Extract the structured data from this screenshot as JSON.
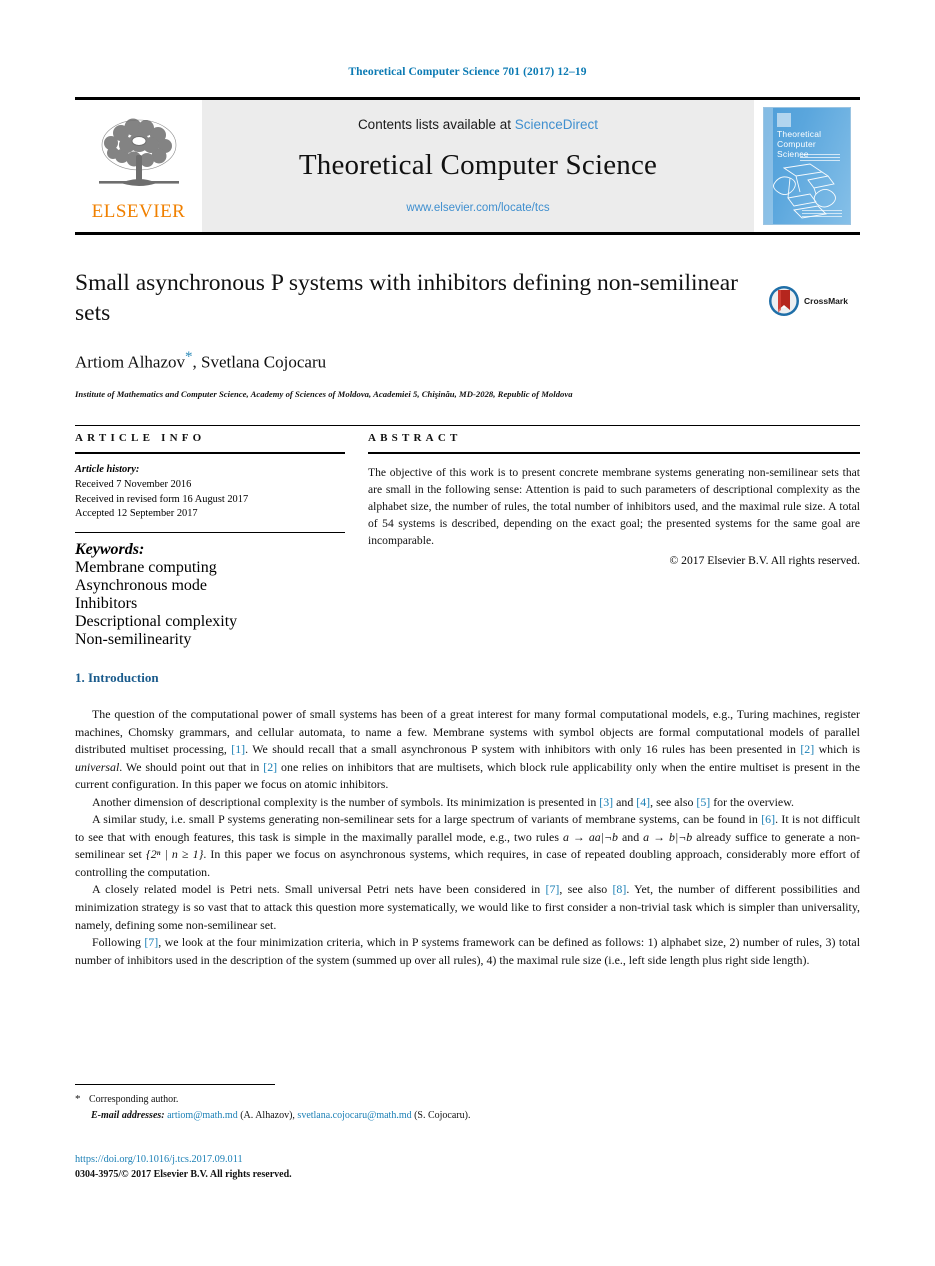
{
  "running_head": "Theoretical Computer Science 701 (2017) 12–19",
  "masthead": {
    "publisher_name": "ELSEVIER",
    "contents_prefix": "Contents lists available at ",
    "sciencedirect": "ScienceDirect",
    "journal_title": "Theoretical Computer Science",
    "journal_url": "www.elsevier.com/locate/tcs",
    "cover_title_line1": "Theoretical",
    "cover_title_line2": "Computer Science"
  },
  "article": {
    "title": "Small asynchronous P systems with inhibitors defining non-semilinear sets",
    "authors": "Artiom Alhazov",
    "authors_rest": ", Svetlana Cojocaru",
    "corresponding_mark": "*",
    "affiliation": "Institute of Mathematics and Computer Science, Academy of Sciences of Moldova, Academiei 5, Chişinău, MD-2028, Republic of Moldova",
    "crossmark_label": "CrossMark"
  },
  "info": {
    "heading": "ARTICLE INFO",
    "history_label": "Article history:",
    "history": [
      "Received 7 November 2016",
      "Received in revised form 16 August 2017",
      "Accepted 12 September 2017"
    ],
    "keywords_label": "Keywords:",
    "keywords": [
      "Membrane computing",
      "Asynchronous mode",
      "Inhibitors",
      "Descriptional complexity",
      "Non-semilinearity"
    ]
  },
  "abstract": {
    "heading": "ABSTRACT",
    "text": "The objective of this work is to present concrete membrane systems generating non-semilinear sets that are small in the following sense: Attention is paid to such parameters of descriptional complexity as the alphabet size, the number of rules, the total number of inhibitors used, and the maximal rule size. A total of 54 systems is described, depending on the exact goal; the presented systems for the same goal are incomparable.",
    "copyright": "© 2017 Elsevier B.V. All rights reserved."
  },
  "body": {
    "section_number": "1.",
    "section_title": "Introduction",
    "paragraphs": [
      {
        "id": "p1",
        "parts": [
          {
            "t": "text",
            "v": "The question of the computational power of small systems has been of a great interest for many formal computational models, e.g., Turing machines, register machines, Chomsky grammars, and cellular automata, to name a few. Membrane systems with symbol objects are formal computational models of parallel distributed multiset processing, "
          },
          {
            "t": "ref",
            "v": "[1]"
          },
          {
            "t": "text",
            "v": ". We should recall that a small asynchronous P system with inhibitors with only 16 rules has been presented in "
          },
          {
            "t": "ref",
            "v": "[2]"
          },
          {
            "t": "text",
            "v": " which is "
          },
          {
            "t": "italic",
            "v": "universal"
          },
          {
            "t": "text",
            "v": ". We should point out that in "
          },
          {
            "t": "ref",
            "v": "[2]"
          },
          {
            "t": "text",
            "v": " one relies on inhibitors that are multisets, which block rule applicability only when the entire multiset is present in the current configuration. In this paper we focus on atomic inhibitors."
          }
        ]
      },
      {
        "id": "p2",
        "parts": [
          {
            "t": "text",
            "v": "Another dimension of descriptional complexity is the number of symbols. Its minimization is presented in "
          },
          {
            "t": "ref",
            "v": "[3]"
          },
          {
            "t": "text",
            "v": " and "
          },
          {
            "t": "ref",
            "v": "[4]"
          },
          {
            "t": "text",
            "v": ", see also "
          },
          {
            "t": "ref",
            "v": "[5]"
          },
          {
            "t": "text",
            "v": " for the overview."
          }
        ]
      },
      {
        "id": "p3",
        "parts": [
          {
            "t": "text",
            "v": "A similar study, i.e. small P systems generating non-semilinear sets for a large spectrum of variants of membrane systems, can be found in "
          },
          {
            "t": "ref",
            "v": "[6]"
          },
          {
            "t": "text",
            "v": ". It is not difficult to see that with enough features, this task is simple in the maximally parallel mode, e.g., two rules "
          },
          {
            "t": "math",
            "v": "a → aa|¬b"
          },
          {
            "t": "text",
            "v": " and "
          },
          {
            "t": "math",
            "v": "a → b|¬b"
          },
          {
            "t": "text",
            "v": " already suffice to generate a non-semilinear set "
          },
          {
            "t": "math",
            "v": "{2ⁿ | n ≥ 1}"
          },
          {
            "t": "text",
            "v": ". In this paper we focus on asynchronous systems, which requires, in case of repeated doubling approach, considerably more effort of controlling the computation."
          }
        ]
      },
      {
        "id": "p4",
        "parts": [
          {
            "t": "text",
            "v": "A closely related model is Petri nets. Small universal Petri nets have been considered in "
          },
          {
            "t": "ref",
            "v": "[7]"
          },
          {
            "t": "text",
            "v": ", see also "
          },
          {
            "t": "ref",
            "v": "[8]"
          },
          {
            "t": "text",
            "v": ". Yet, the number of different possibilities and minimization strategy is so vast that to attack this question more systematically, we would like to first consider a non-trivial task which is simpler than universality, namely, defining some non-semilinear set."
          }
        ]
      },
      {
        "id": "p5",
        "parts": [
          {
            "t": "text",
            "v": "Following "
          },
          {
            "t": "ref",
            "v": "[7]"
          },
          {
            "t": "text",
            "v": ", we look at the four minimization criteria, which in P systems framework can be defined as follows: 1) alphabet size, 2) number of rules, 3) total number of inhibitors used in the description of the system (summed up over all rules), 4) the maximal rule size (i.e., left side length plus right side length)."
          }
        ]
      }
    ]
  },
  "footnotes": {
    "corresponding_star": "*",
    "corresponding_text": "Corresponding author.",
    "email_label": "E-mail addresses:",
    "email1": "artiom@math.md",
    "email1_owner": "(A. Alhazov)",
    "email2": "svetlana.cojocaru@math.md",
    "email2_owner": "(S. Cojocaru).",
    "doi": "https://doi.org/10.1016/j.tcs.2017.09.011",
    "issn_line": "0304-3975/© 2017 Elsevier B.V. All rights reserved."
  },
  "colors": {
    "link_blue": "#1a7fb5",
    "sciencedirect_blue": "#3f8fcf",
    "elsevier_orange": "#f08000",
    "section_blue": "#1a5b8c"
  }
}
